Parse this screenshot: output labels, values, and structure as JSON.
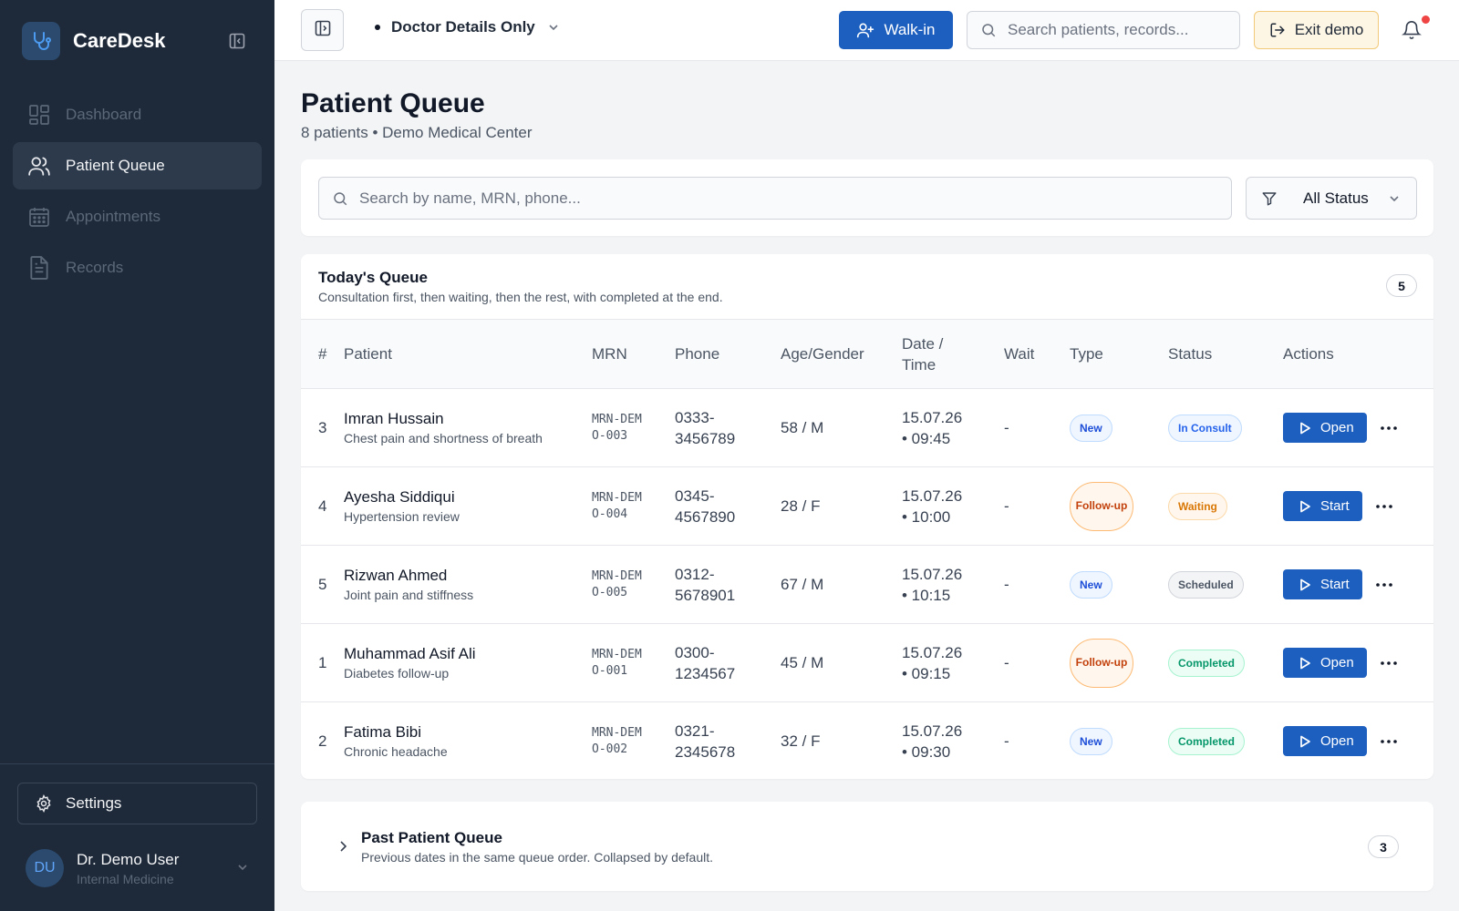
{
  "app": {
    "name": "CareDesk"
  },
  "sidebar": {
    "items": [
      {
        "label": "Dashboard",
        "icon": "dashboard-icon",
        "active": false
      },
      {
        "label": "Patient Queue",
        "icon": "users-icon",
        "active": true
      },
      {
        "label": "Appointments",
        "icon": "calendar-icon",
        "active": false
      },
      {
        "label": "Records",
        "icon": "document-icon",
        "active": false
      }
    ],
    "settings_label": "Settings",
    "user": {
      "initials": "DU",
      "name": "Dr. Demo User",
      "role": "Internal Medicine"
    }
  },
  "header": {
    "mode_label": "Doctor Details Only",
    "walkin_label": "Walk-in",
    "search_placeholder": "Search patients, records...",
    "exit_label": "Exit demo"
  },
  "page": {
    "title": "Patient Queue",
    "subtitle": "8 patients • Demo Medical Center",
    "search_placeholder": "Search by name, MRN, phone...",
    "status_filter": "All Status"
  },
  "queue": {
    "title": "Today's Queue",
    "subtitle": "Consultation first, then waiting, then the rest, with completed at the end.",
    "count": "5",
    "columns": [
      "#",
      "Patient",
      "MRN",
      "Phone",
      "Age/Gender",
      "Date / Time",
      "Wait",
      "Type",
      "Status",
      "Actions"
    ],
    "rows": [
      {
        "num": "3",
        "name": "Imran Hussain",
        "note": "Chest pain and shortness of breath",
        "mrn": "MRN-DEMO-003",
        "phone": "0333-3456789",
        "age": "58 / M",
        "date": "15.07.26",
        "time": "• 09:45",
        "wait": "-",
        "type": "New",
        "status": "In Consult",
        "action": "Open"
      },
      {
        "num": "4",
        "name": "Ayesha Siddiqui",
        "note": "Hypertension review",
        "mrn": "MRN-DEMO-004",
        "phone": "0345-4567890",
        "age": "28 / F",
        "date": "15.07.26",
        "time": "• 10:00",
        "wait": "-",
        "type": "Follow-up",
        "status": "Waiting",
        "action": "Start"
      },
      {
        "num": "5",
        "name": "Rizwan Ahmed",
        "note": "Joint pain and stiffness",
        "mrn": "MRN-DEMO-005",
        "phone": "0312-5678901",
        "age": "67 / M",
        "date": "15.07.26",
        "time": "• 10:15",
        "wait": "-",
        "type": "New",
        "status": "Scheduled",
        "action": "Start"
      },
      {
        "num": "1",
        "name": "Muhammad Asif Ali",
        "note": "Diabetes follow-up",
        "mrn": "MRN-DEMO-001",
        "phone": "0300-1234567",
        "age": "45 / M",
        "date": "15.07.26",
        "time": "• 09:15",
        "wait": "-",
        "type": "Follow-up",
        "status": "Completed",
        "action": "Open"
      },
      {
        "num": "2",
        "name": "Fatima Bibi",
        "note": "Chronic headache",
        "mrn": "MRN-DEMO-002",
        "phone": "0321-2345678",
        "age": "32 / F",
        "date": "15.07.26",
        "time": "• 09:30",
        "wait": "-",
        "type": "New",
        "status": "Completed",
        "action": "Open"
      }
    ]
  },
  "past_queue": {
    "title": "Past Patient Queue",
    "subtitle": "Previous dates in the same queue order. Collapsed by default.",
    "count": "3"
  },
  "colors": {
    "sidebar_bg": "#1e2a3a",
    "primary": "#1d5fbf",
    "exit_bg": "#fef6e4",
    "badge_alert": "#ef4444"
  }
}
